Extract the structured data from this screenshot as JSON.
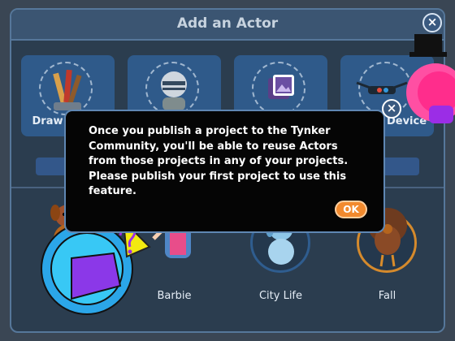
{
  "dialog": {
    "title": "Add an Actor",
    "close_glyph": "×"
  },
  "tiles": [
    {
      "label": "Draw",
      "icon": "pencil-brush-icon"
    },
    {
      "label": "",
      "icon": "football-player-icon"
    },
    {
      "label": "",
      "icon": "photo-icon"
    },
    {
      "label": "Device",
      "icon": "drone-icon"
    }
  ],
  "actors": [
    {
      "label": "",
      "icon": "dog-icon"
    },
    {
      "label": "Barbie",
      "icon": "barbie-icon"
    },
    {
      "label": "City Life",
      "icon": "blue-dog-icon"
    },
    {
      "label": "Fall",
      "icon": "turkey-icon"
    }
  ],
  "modal": {
    "message": "Once you publish a project to the Tynker Community, you'll be able to reuse Actors from those projects in any of your projects. Please publish your first project to use this feature.",
    "ok_label": "OK",
    "close_glyph": "×"
  },
  "colors": {
    "accent": "#f28a2e",
    "panel": "#2b3d4f",
    "tile": "#2f5a8a"
  }
}
